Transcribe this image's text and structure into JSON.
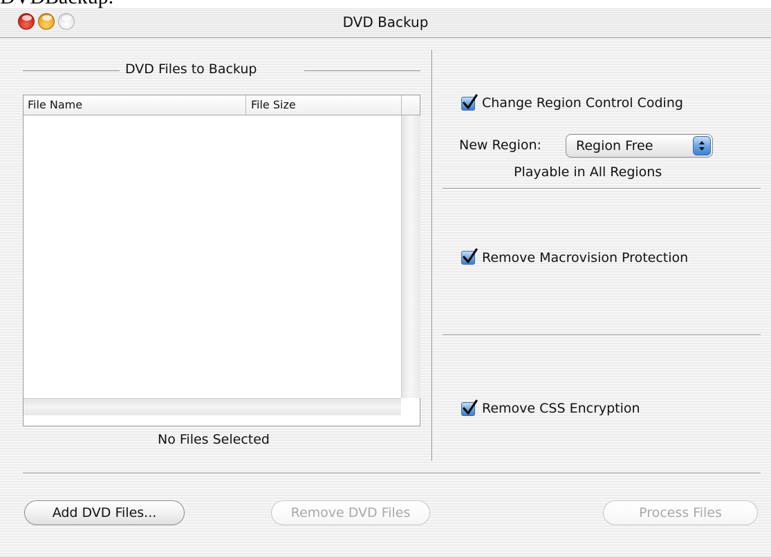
{
  "caption": "DVDBackup.",
  "window": {
    "title": "DVD Backup"
  },
  "files_panel": {
    "group_title": "DVD Files to Backup",
    "columns": [
      "File Name",
      "File Size"
    ],
    "rows": [],
    "status": "No Files Selected"
  },
  "region": {
    "checkbox_label": "Change Region Control Coding",
    "checked": true,
    "new_region_label": "New Region:",
    "selected_region": "Region Free",
    "description": "Playable in All Regions"
  },
  "macrovision": {
    "checkbox_label": "Remove Macrovision Protection",
    "checked": true
  },
  "css": {
    "checkbox_label": "Remove CSS Encryption",
    "checked": true
  },
  "buttons": {
    "add_label": "Add DVD Files...",
    "remove_label": "Remove DVD Files",
    "process_label": "Process Files"
  },
  "colors": {
    "accent": "#3a7fd4",
    "close": "#d42a1c",
    "minimize": "#f0a820",
    "zoom": "#e6e6e6"
  }
}
